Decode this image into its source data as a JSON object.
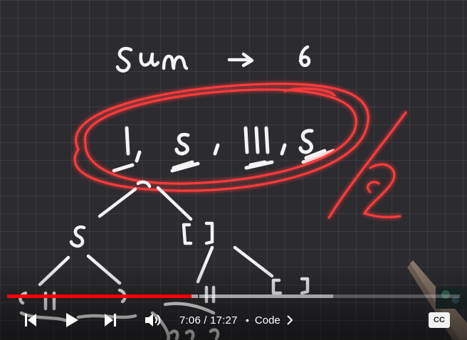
{
  "player": {
    "progress_played": 0.408,
    "progress_buffered": 0.72,
    "time_current": "7:06",
    "time_separator": " / ",
    "time_total": "17:27",
    "chapter_separator": "•",
    "chapter_label": "Code",
    "cc_label": "CC",
    "accent_color": "#ff0000"
  },
  "controls": {
    "previous_icon": "skip-previous-icon",
    "play_icon": "play-icon",
    "next_icon": "skip-next-icon",
    "volume_icon": "volume-icon",
    "chapter_icon": "chevron-right-icon"
  }
}
